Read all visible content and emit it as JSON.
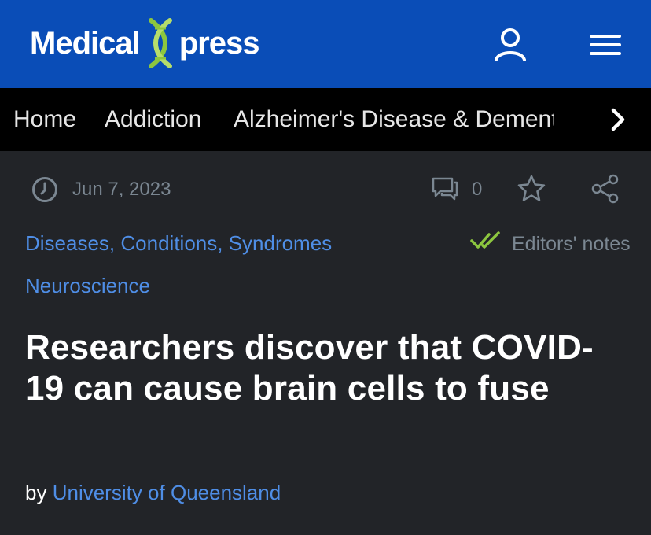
{
  "header": {
    "logo_word1": "Medical",
    "logo_word2": "press",
    "user_icon": "user-icon",
    "menu_icon": "hamburger-menu-icon",
    "colors": {
      "bar": "#0a4db7",
      "dna_green": "#8cc63f"
    }
  },
  "catnav": {
    "items": [
      {
        "label": "Home"
      },
      {
        "label": "Addiction"
      },
      {
        "label": "Alzheimer's Disease & Dementia"
      }
    ],
    "next_icon": "chevron-right-icon"
  },
  "meta": {
    "date": "Jun 7, 2023",
    "comment_count": "0",
    "icons": [
      "clock-icon",
      "comment-icon",
      "star-icon",
      "share-icon"
    ]
  },
  "tags": {
    "primary": "Diseases, Conditions, Syndromes",
    "secondary": "Neuroscience",
    "editors_notes": "Editors' notes"
  },
  "article": {
    "title": "Researchers discover that COVID-19 can cause brain cells to fuse",
    "by_label": "by",
    "author": "University of Queensland"
  }
}
